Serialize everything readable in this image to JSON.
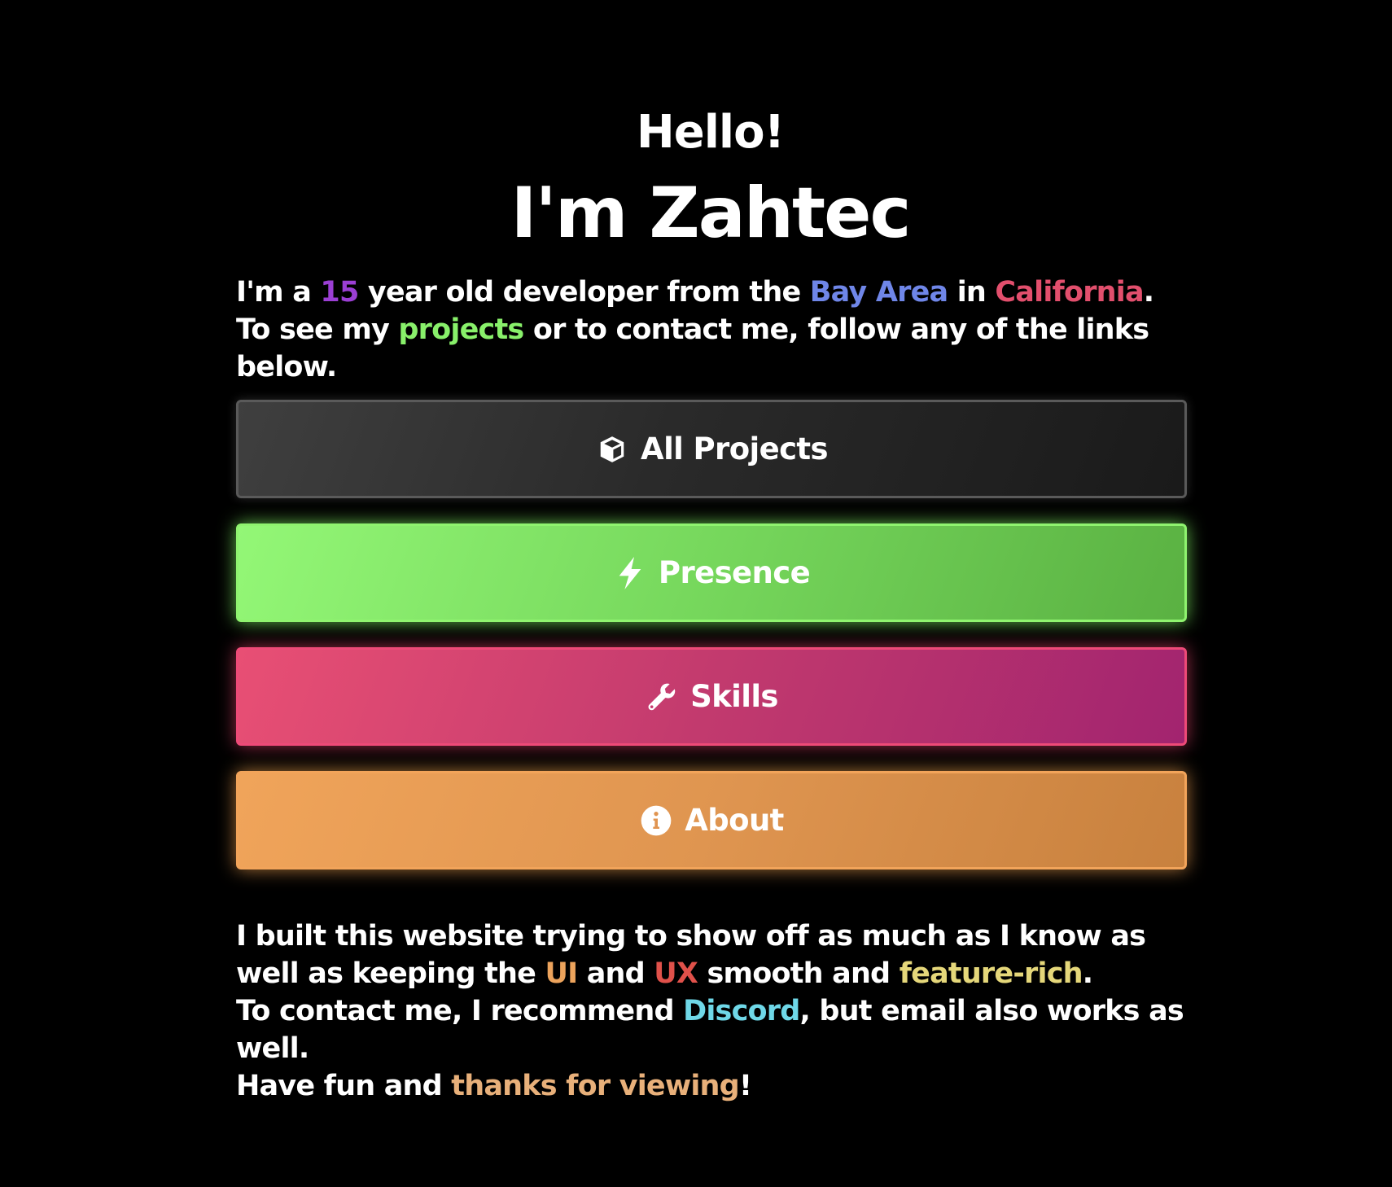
{
  "header": {
    "hello": "Hello!",
    "name": "I'm Zahtec"
  },
  "intro": {
    "p1": "I'm a ",
    "age": "15",
    "p2": " year old developer from the ",
    "area": "Bay Area",
    "p3": " in ",
    "state": "California",
    "p4": ". To see my ",
    "projects": "projects",
    "p5": " or to contact me, follow any of the links below."
  },
  "buttons": {
    "projects": {
      "label": "All Projects",
      "icon": "cube-icon",
      "color": "#2a2a2a"
    },
    "presence": {
      "label": "Presence",
      "icon": "bolt-icon",
      "color": "#7cdc5e"
    },
    "skills": {
      "label": "Skills",
      "icon": "wrench-icon",
      "color": "#c83a6f"
    },
    "about": {
      "label": "About",
      "icon": "info-icon",
      "color": "#e09450"
    }
  },
  "outro": {
    "l1": "I built this website trying to show off as much as I know as well as keeping the ",
    "ui": "UI",
    "l2": " and ",
    "ux": "UX",
    "l3": " smooth and ",
    "feature": "feature-rich",
    "l4": ".",
    "l5": "To contact me, I recommend ",
    "discord": "Discord",
    "l6": ", but email also works as well.",
    "l7": "Have fun and ",
    "thanks": "thanks for viewing",
    "l8": "!"
  }
}
